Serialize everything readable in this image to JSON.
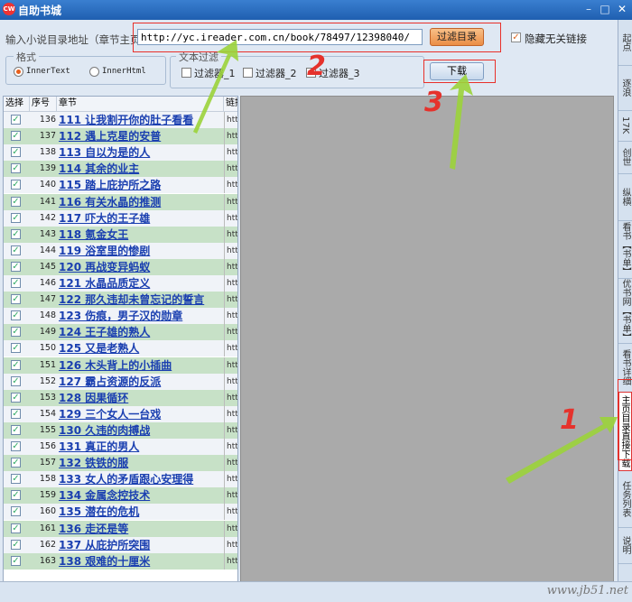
{
  "window": {
    "title": "自助书城",
    "app_icon_text": "CW",
    "minimize": "–",
    "maximize": "□",
    "close": "✕"
  },
  "toolbar": {
    "url_label": "输入小说目录地址（章节主页）",
    "url_value": "http://yc.ireader.com.cn/book/78497/12398040/",
    "filter_button": "过滤目录",
    "hide_links_label": "隐藏无关链接",
    "hide_links_checked": true,
    "download_button": "下载"
  },
  "format_group": {
    "title": "格式",
    "options": [
      "InnerText",
      "InnerHtml"
    ],
    "selected": "InnerText"
  },
  "text_filter_group": {
    "title": "文本过滤",
    "filters": [
      "过滤器_1",
      "过滤器_2",
      "过滤器_3"
    ]
  },
  "table": {
    "headers": [
      "选择",
      "序号",
      "章节",
      "链接"
    ],
    "link_prefix": "http",
    "rows": [
      {
        "num": "136",
        "chapter": "111 让我割开你的肚子看看"
      },
      {
        "num": "137",
        "chapter": "112 遇上克星的安普"
      },
      {
        "num": "138",
        "chapter": "113 自以为是的人"
      },
      {
        "num": "139",
        "chapter": "114 其余的业主"
      },
      {
        "num": "140",
        "chapter": "115 踏上庇护所之路"
      },
      {
        "num": "141",
        "chapter": "116 有关水晶的推测"
      },
      {
        "num": "142",
        "chapter": "117 吓大的王子雄"
      },
      {
        "num": "143",
        "chapter": "118 氪金女王"
      },
      {
        "num": "144",
        "chapter": "119 浴室里的惨剧"
      },
      {
        "num": "145",
        "chapter": "120 再战变异蚂蚁"
      },
      {
        "num": "146",
        "chapter": "121 水晶品质定义"
      },
      {
        "num": "147",
        "chapter": "122 那久违却未曾忘记的誓言"
      },
      {
        "num": "148",
        "chapter": "123 伤痕，男子汉的勋章"
      },
      {
        "num": "149",
        "chapter": "124 王子雄的熟人"
      },
      {
        "num": "150",
        "chapter": "125 又是老熟人"
      },
      {
        "num": "151",
        "chapter": "126 木头背上的小插曲"
      },
      {
        "num": "152",
        "chapter": "127 霸占资源的反派"
      },
      {
        "num": "153",
        "chapter": "128 因果循环"
      },
      {
        "num": "154",
        "chapter": "129 三个女人一台戏"
      },
      {
        "num": "155",
        "chapter": "130 久违的肉搏战"
      },
      {
        "num": "156",
        "chapter": "131 真正的男人"
      },
      {
        "num": "157",
        "chapter": "132 铁铁的服"
      },
      {
        "num": "158",
        "chapter": "133 女人的矛盾跟心安理得"
      },
      {
        "num": "159",
        "chapter": "134 金属念控技术"
      },
      {
        "num": "160",
        "chapter": "135 潜在的危机"
      },
      {
        "num": "161",
        "chapter": "136 走还是等"
      },
      {
        "num": "162",
        "chapter": "137 从庇护所突围"
      },
      {
        "num": "163",
        "chapter": "138 艰难的十厘米"
      }
    ]
  },
  "side_tabs": [
    "起点",
    "逐浪",
    "17K",
    "创世",
    "纵横",
    "看书【书单】",
    "优书网【书单】",
    "看书详细",
    "主页目录直接下载",
    "任务列表",
    "说明"
  ],
  "active_side_tab": "主页目录直接下载",
  "annotations": [
    "1",
    "2",
    "3"
  ],
  "watermark": "www.jb51.net",
  "colors": {
    "annotation_red": "#e5322c",
    "arrow_green": "#9bd33a"
  }
}
